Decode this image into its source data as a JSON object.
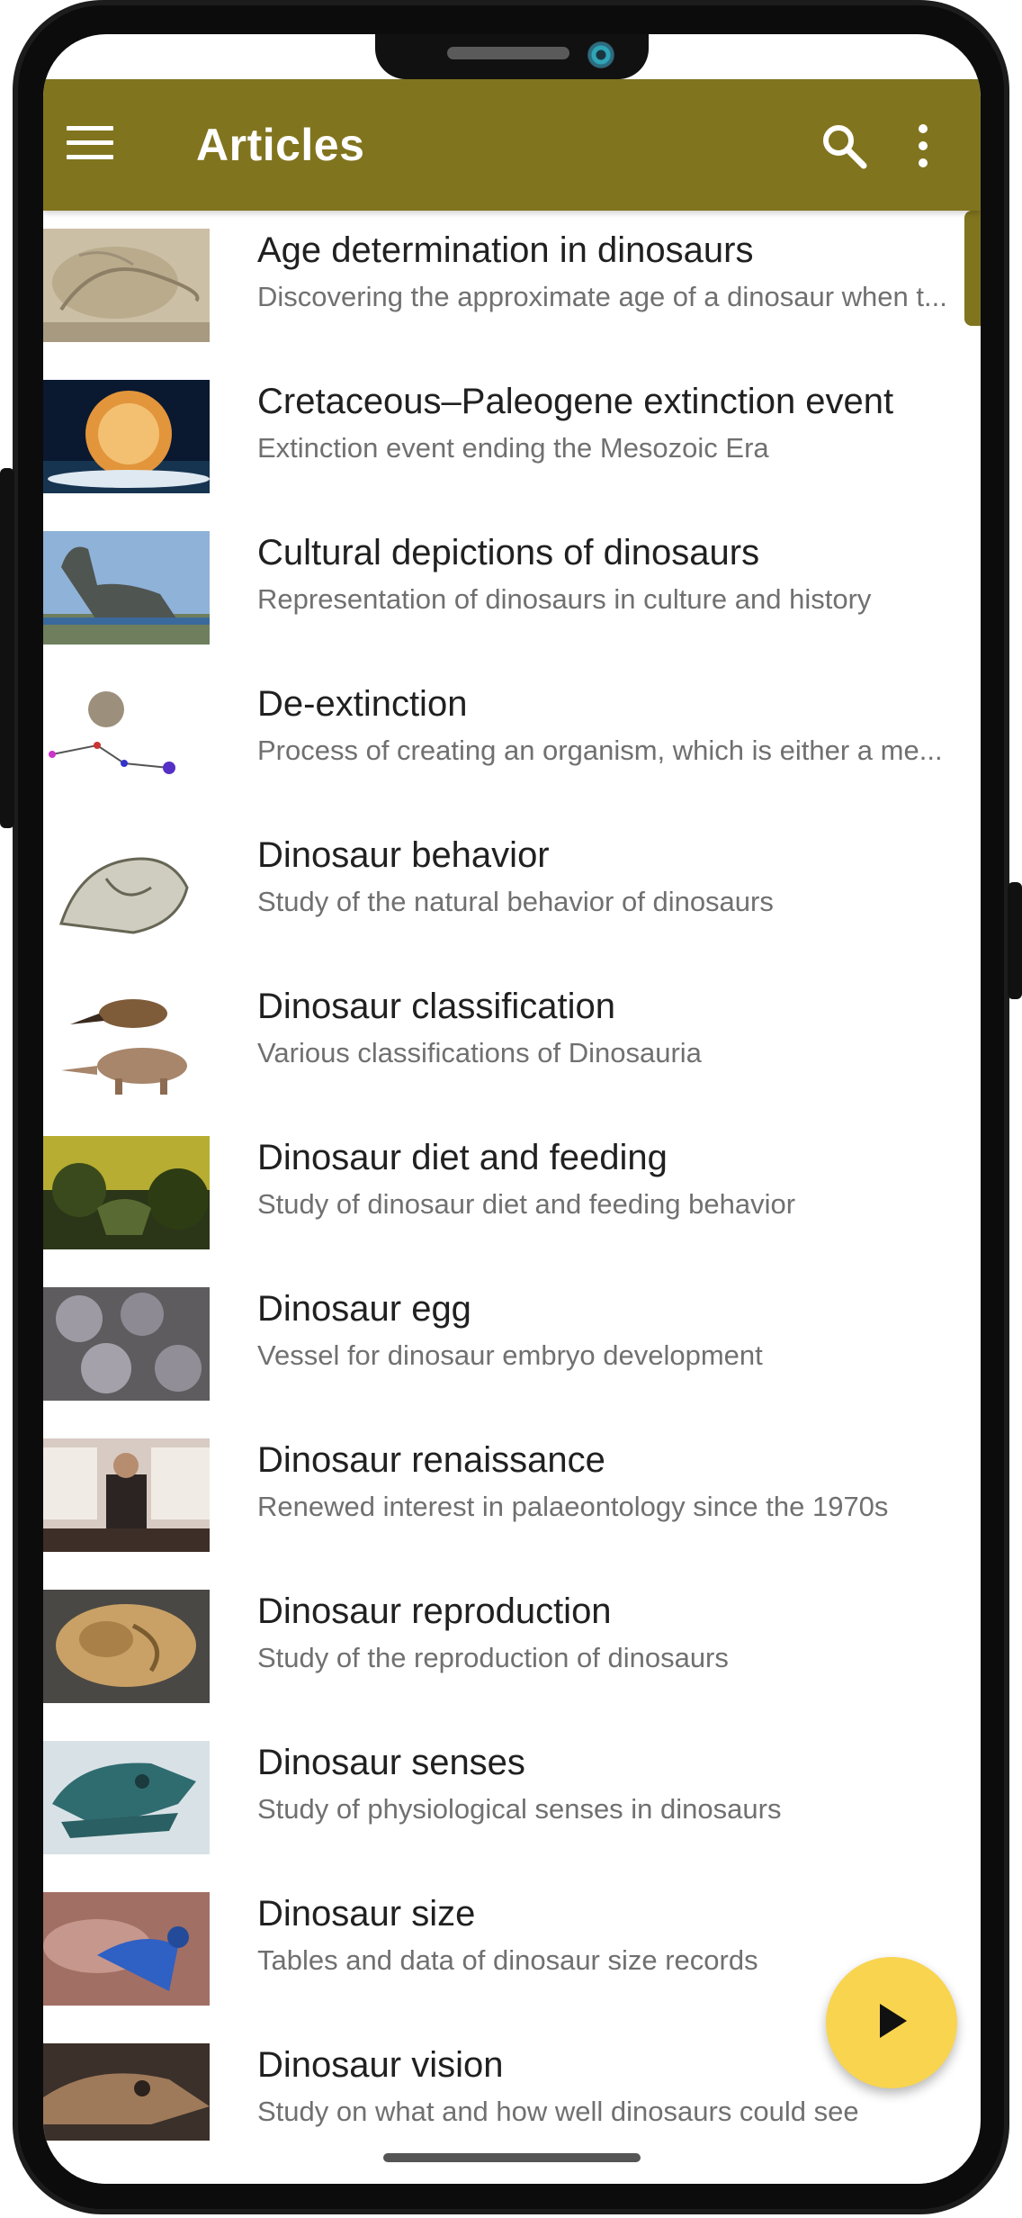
{
  "app_bar": {
    "title": "Articles",
    "menu_icon": "menu-icon",
    "search_icon": "search-icon",
    "more_icon": "more-vert-icon",
    "color": "#81741e"
  },
  "articles": [
    {
      "title": "Age determination in dinosaurs",
      "description": "Discovering the approximate age of a dinosaur when t..."
    },
    {
      "title": "Cretaceous–Paleogene extinction event",
      "description": "Extinction event ending the Mesozoic Era"
    },
    {
      "title": "Cultural depictions of dinosaurs",
      "description": "Representation of dinosaurs in culture and history"
    },
    {
      "title": "De-extinction",
      "description": "Process of creating an organism, which is either a me..."
    },
    {
      "title": "Dinosaur behavior",
      "description": "Study of the natural behavior of dinosaurs"
    },
    {
      "title": "Dinosaur classification",
      "description": "Various classifications of Dinosauria"
    },
    {
      "title": "Dinosaur diet and feeding",
      "description": "Study of dinosaur diet and feeding behavior"
    },
    {
      "title": "Dinosaur egg",
      "description": "Vessel for dinosaur embryo development"
    },
    {
      "title": "Dinosaur renaissance",
      "description": "Renewed interest in palaeontology since the 1970s"
    },
    {
      "title": "Dinosaur reproduction",
      "description": "Study of the reproduction of dinosaurs"
    },
    {
      "title": "Dinosaur senses",
      "description": "Study of physiological senses in dinosaurs"
    },
    {
      "title": "Dinosaur size",
      "description": "Tables and data of dinosaur size records"
    },
    {
      "title": "Dinosaur vision",
      "description": "Study on what and how well dinosaurs could see"
    }
  ],
  "fab": {
    "icon": "play-icon",
    "color": "#f9d44f"
  }
}
